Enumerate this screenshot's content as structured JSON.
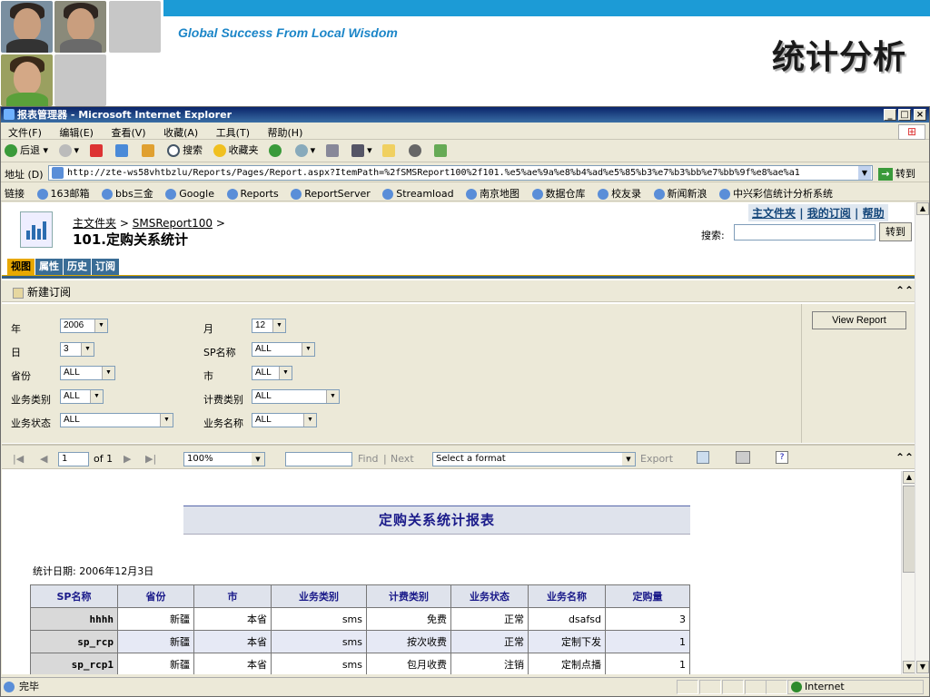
{
  "slide": {
    "slogan": "Global Success From Local Wisdom",
    "title": "统计分析"
  },
  "window": {
    "title": "报表管理器 - Microsoft Internet Explorer",
    "minimize": "_",
    "maximize": "□",
    "close": "×"
  },
  "menu": [
    "文件(F)",
    "编辑(E)",
    "查看(V)",
    "收藏(A)",
    "工具(T)",
    "帮助(H)"
  ],
  "toolbar": {
    "back": "后退",
    "forward": "",
    "search": "搜索",
    "favorites": "收藏夹"
  },
  "address": {
    "label": "地址 (D)",
    "url": "http://zte-ws58vhtbzlu/Reports/Pages/Report.aspx?ItemPath=%2fSMSReport100%2f101.%e5%ae%9a%e8%b4%ad%e5%85%b3%e7%b3%bb%e7%bb%9f%e8%ae%a1",
    "go": "转到"
  },
  "links": {
    "label": "链接",
    "items": [
      "163邮箱",
      "bbs三金",
      "Google",
      "Reports",
      "ReportServer",
      "Streamload",
      "南京地图",
      "数据仓库",
      "校友录",
      "新闻新浪",
      "中兴彩信统计分析系统"
    ]
  },
  "page": {
    "toplinks": [
      "主文件夹",
      "我的订阅",
      "帮助"
    ],
    "separator": "|",
    "breadcrumb": {
      "home": "主文件夹",
      "sep": ">",
      "folder": "SMSReport100"
    },
    "report_title": "101.定购关系统计",
    "search_label": "搜索:",
    "go_label": "转到",
    "tabs": [
      "视图",
      "属性",
      "历史",
      "订阅"
    ],
    "new_subscription": "新建订阅",
    "collapse": "⌃⌃"
  },
  "params": {
    "labels": {
      "year": "年",
      "month": "月",
      "day": "日",
      "sp": "SP名称",
      "province": "省份",
      "city": "市",
      "biztype": "业务类别",
      "feetype": "计费类别",
      "bizstate": "业务状态",
      "bizname": "业务名称"
    },
    "values": {
      "year": "2006",
      "month": "12",
      "day": "3",
      "sp": "ALL",
      "province": "ALL",
      "city": "ALL",
      "biztype": "ALL",
      "feetype": "ALL",
      "bizstate": "ALL",
      "bizname": "ALL"
    },
    "view_report": "View Report"
  },
  "reporttoolbar": {
    "page": "1",
    "of": "of 1",
    "zoom": "100%",
    "find": "Find",
    "pipe": "|",
    "next": "Next",
    "format": "Select a format",
    "export": "Export"
  },
  "report": {
    "title": "定购关系统计报表",
    "date": "统计日期: 2006年12月3日",
    "columns": [
      "SP名称",
      "省份",
      "市",
      "业务类别",
      "计费类别",
      "业务状态",
      "业务名称",
      "定购量"
    ],
    "rows": [
      [
        "hhhh",
        "新疆",
        "本省",
        "sms",
        "免费",
        "正常",
        "dsafsd",
        "3"
      ],
      [
        "sp_rcp",
        "新疆",
        "本省",
        "sms",
        "按次收费",
        "正常",
        "定制下发",
        "1"
      ],
      [
        "sp_rcp1",
        "新疆",
        "本省",
        "sms",
        "包月收费",
        "注销",
        "定制点播",
        "1"
      ]
    ]
  },
  "status": {
    "text": "完毕",
    "zone": "Internet"
  }
}
